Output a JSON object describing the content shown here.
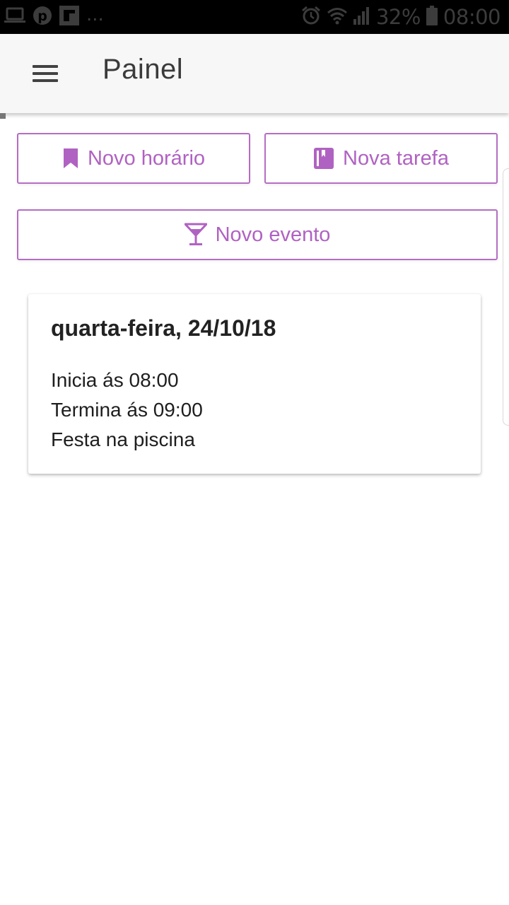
{
  "status_bar": {
    "left_icons": [
      "laptop-icon",
      "pinterest-icon",
      "flipboard-icon"
    ],
    "overflow": "...",
    "right_icons": [
      "alarm-icon",
      "wifi-icon",
      "signal-icon",
      "battery-icon"
    ],
    "battery": "32%",
    "time": "08:00"
  },
  "app_bar": {
    "menu_icon": "menu-icon",
    "title": "Painel"
  },
  "actions": {
    "new_schedule": {
      "label": "Novo horário",
      "icon": "bookmark-icon"
    },
    "new_task": {
      "label": "Nova tarefa",
      "icon": "book-icon"
    },
    "new_event": {
      "label": "Novo evento",
      "icon": "cocktail-icon"
    }
  },
  "event_card": {
    "date": "quarta-feira, 24/10/18",
    "starts": "Inicia ás 08:00",
    "ends": "Termina ás 09:00",
    "description": "Festa na piscina"
  },
  "colors": {
    "accent": "#b56dc4",
    "status_bar": "#000000",
    "app_bar": "#f7f7f7"
  }
}
